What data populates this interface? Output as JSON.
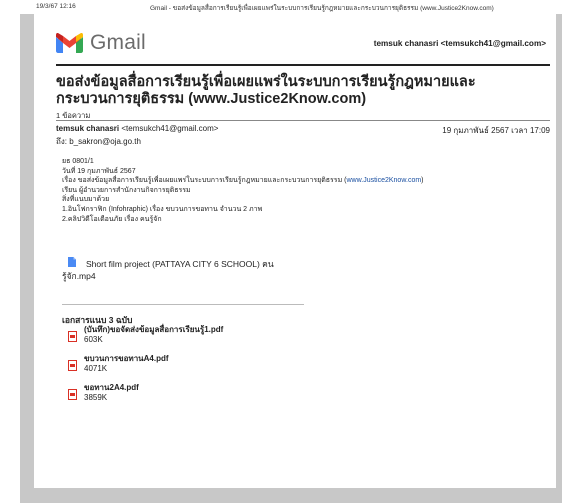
{
  "print_header": {
    "date": "19/3/67 12:16",
    "title": "Gmail - ขอส่งข้อมูลสื่อการเรียนรู้เพื่อเผยแพร่ในระบบการเรียนรู้กฎหมายและกระบวนการยุติธรรม (www.Justice2Know.com)"
  },
  "header": {
    "brand": "Gmail",
    "account": "temsuk chanasri <temsukch41@gmail.com>"
  },
  "email": {
    "subject": "ขอส่งข้อมูลสื่อการเรียนรู้เพื่อเผยแพร่ในระบบการเรียนรู้กฎหมายและกระบวนการยุติธรรม (www.Justice2Know.com)",
    "message_count": "1 ข้อความ",
    "from_name": "temsuk chanasri",
    "from_email": "<temsukch41@gmail.com>",
    "to": "ถึง: b_sakron@oja.go.th",
    "date": "19 กุมภาพันธ์ 2567 เวลา 17:09",
    "body": {
      "line1": "ยธ 0801/1",
      "line2": "วันที่ 19 กุมภาพันธ์ 2567",
      "line3_prefix": "เรื่อง ขอส่งข้อมูลสื่อการเรียนรู้เพื่อเผยแพร่ในระบบการเรียนรู้กฎหมายและกระบวนการยุติธรรม (",
      "line3_link": "www.Justice2Know.com",
      "line3_suffix": ")",
      "line4": "เรียน ผู้อำนวยการสำนักงานกิจการยุติธรรม",
      "line5": "สิ่งที่แนบมาด้วย",
      "line6": "1.อินโฟกราฟิก (Infohraphic) เรื่อง ขบวนการขอทาน จำนวน 2 ภาพ",
      "line7": "2.คลิปวิดีโอเตือนภัย เรื่อง คนรู้จัก"
    },
    "drive_attachment": {
      "line1": "Short film project (PATTAYA CITY 6 SCHOOL) คน",
      "line2": "รู้จัก.mp4"
    },
    "attachments_heading": "เอกสารแนบ 3 ฉบับ",
    "attachments": [
      {
        "name": "(บันทึก)ขอจัดส่งข้อมูลสื่อการเรียนรู้1.pdf",
        "size": "603K"
      },
      {
        "name": "ขบวนการขอทานA4.pdf",
        "size": "4071K"
      },
      {
        "name": "ขอทาน2A4.pdf",
        "size": "3859K"
      }
    ]
  },
  "colors": {
    "gmail_red": "#ea4335",
    "gmail_blue": "#4285f4",
    "gmail_green": "#34a853",
    "gmail_yellow": "#fbbc04",
    "link": "#1a4fa0",
    "pdf_red": "#d93025",
    "drive_blue": "#4a8af4",
    "frame_gray": "#c8c8c8"
  },
  "icons": {
    "logo": "gmail-logo-icon",
    "drive_file": "file-icon",
    "attachment": "pdf-icon"
  }
}
